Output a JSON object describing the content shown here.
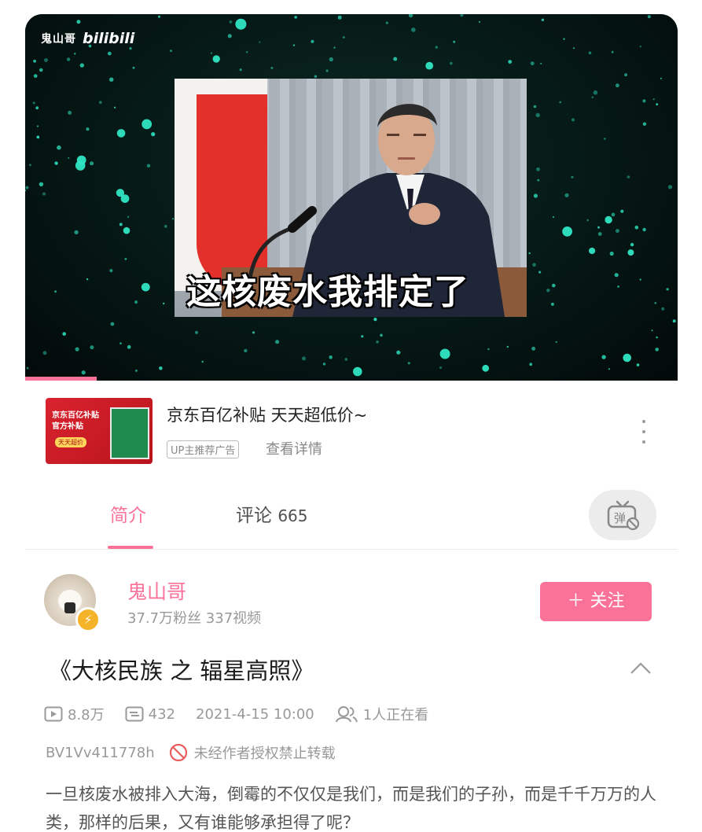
{
  "video": {
    "uploader_watermark": "鬼山哥",
    "platform_logo": "bilibili",
    "meme_caption": "这核废水我排定了",
    "progress_fraction": 0.11
  },
  "ad": {
    "thumb_text": "京东百亿补贴 官方补贴",
    "thumb_tag": "天天超价",
    "title": "京东百亿补贴 天天超低价~",
    "tag": "UP主推荐广告",
    "link": "查看详情"
  },
  "tabs": {
    "intro": "简介",
    "comments": "评论",
    "comments_count": "665"
  },
  "uploader": {
    "name": "鬼山哥",
    "stats": "37.7万粉丝   337视频",
    "follow": "＋ 关注"
  },
  "video_info": {
    "title": "《大核民族 之 辐星高照》",
    "views": "8.8万",
    "danmaku": "432",
    "date": "2021-4-15 10:00",
    "watching": "1人正在看",
    "bvid": "BV1Vv411778h",
    "copyright": "未经作者授权禁止转载",
    "description": "一旦核废水被排入大海，倒霉的不仅仅是我们，而是我们的子孙，而是千千万万的人类，那样的后果，又有谁能够承担得了呢？"
  },
  "colors": {
    "accent": "#fb7299",
    "particles": "#2fe6c4"
  }
}
